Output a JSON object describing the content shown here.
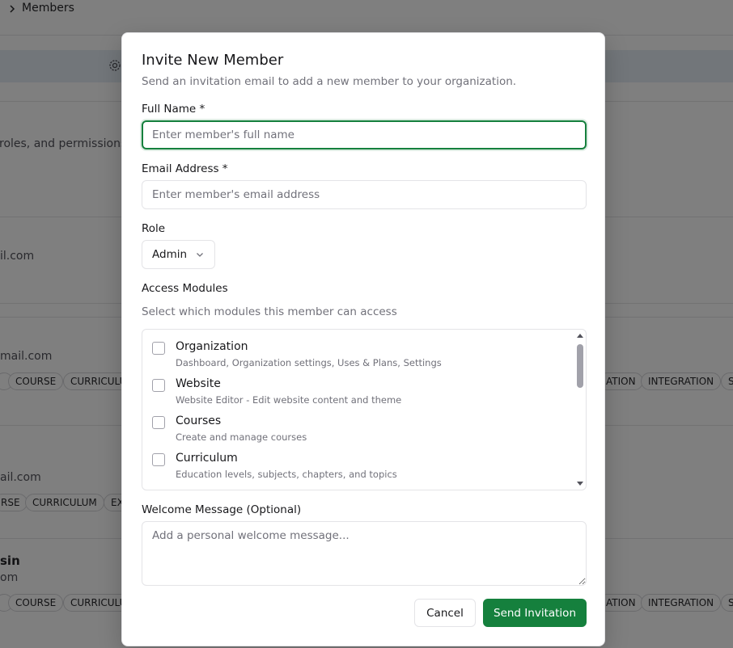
{
  "background": {
    "breadcrumb": "Members",
    "description_fragment": "roles, and permissions.",
    "emails": [
      "il.com",
      "mail.com",
      "ail.com",
      "om"
    ],
    "name_fragment": "sin",
    "chips_row1_left": [
      "COURSE",
      "CURRICULU"
    ],
    "chips_row1_right": [
      "ATION",
      "INTEGRATION",
      "S"
    ],
    "chips_row2_left": [
      "RSE",
      "CURRICULUM",
      "EX"
    ],
    "chips_row3_left": [
      "COURSE",
      "CURRICULU"
    ],
    "chips_row3_right": [
      "ATION",
      "INTEGRATION",
      "S"
    ]
  },
  "dialog": {
    "title": "Invite New Member",
    "description": "Send an invitation email to add a new member to your organization.",
    "full_name": {
      "label": "Full Name *",
      "value": "",
      "placeholder": "Enter member's full name"
    },
    "email": {
      "label": "Email Address *",
      "value": "",
      "placeholder": "Enter member's email address"
    },
    "role": {
      "label": "Role",
      "selected": "Admin"
    },
    "modules": {
      "label": "Access Modules",
      "helper": "Select which modules this member can access",
      "items": [
        {
          "name": "Organization",
          "description": "Dashboard, Organization settings, Uses & Plans, Settings",
          "checked": false
        },
        {
          "name": "Website",
          "description": "Website Editor - Edit website content and theme",
          "checked": false
        },
        {
          "name": "Courses",
          "description": "Create and manage courses",
          "checked": false
        },
        {
          "name": "Curriculum",
          "description": "Education levels, subjects, chapters, and topics",
          "checked": false
        }
      ]
    },
    "welcome": {
      "label": "Welcome Message (Optional)",
      "value": "",
      "placeholder": "Add a personal welcome message..."
    },
    "cancel_label": "Cancel",
    "send_label": "Send Invitation"
  },
  "colors": {
    "primary": "#15803d",
    "overlay": "rgba(0,0,0,0.5)",
    "border": "#e4e4e7",
    "muted_text": "#71717a"
  }
}
